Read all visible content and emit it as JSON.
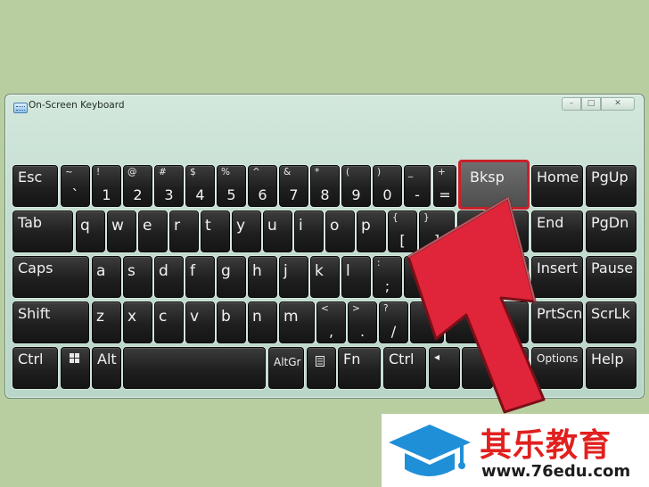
{
  "window": {
    "title": "On-Screen Keyboard",
    "controls": [
      "–",
      "□",
      "✕"
    ]
  },
  "keys": {
    "esc": "Esc",
    "tilde": {
      "shift": "~",
      "main": "`"
    },
    "d1": {
      "shift": "!",
      "main": "1"
    },
    "d2": {
      "shift": "@",
      "main": "2"
    },
    "d3": {
      "shift": "#",
      "main": "3"
    },
    "d4": {
      "shift": "$",
      "main": "4"
    },
    "d5": {
      "shift": "%",
      "main": "5"
    },
    "d6": {
      "shift": "^",
      "main": "6"
    },
    "d7": {
      "shift": "&",
      "main": "7"
    },
    "d8": {
      "shift": "*",
      "main": "8"
    },
    "d9": {
      "shift": "(",
      "main": "9"
    },
    "d0": {
      "shift": ")",
      "main": "0"
    },
    "minus": {
      "shift": "_",
      "main": "-"
    },
    "equals": {
      "shift": "+",
      "main": "="
    },
    "bksp": "Bksp",
    "home": "Home",
    "pgup": "PgUp",
    "tab": "Tab",
    "q": "q",
    "w": "w",
    "e": "e",
    "r": "r",
    "t": "t",
    "y": "y",
    "u": "u",
    "i": "i",
    "o": "o",
    "p": "p",
    "lbracket": {
      "shift": "{",
      "main": "["
    },
    "rbracket": {
      "shift": "}",
      "main": "]"
    },
    "end": "End",
    "pgdn": "PgDn",
    "caps": "Caps",
    "a": "a",
    "s": "s",
    "d": "d",
    "f": "f",
    "g": "g",
    "h": "h",
    "j": "j",
    "k": "k",
    "l": "l",
    "semicolon": {
      "shift": ":",
      "main": ";"
    },
    "quote": {
      "shift": "\"",
      "main": "'"
    },
    "insert": "Insert",
    "pause": "Pause",
    "shift": "Shift",
    "z": "z",
    "x": "x",
    "c": "c",
    "v": "v",
    "b": "b",
    "n": "n",
    "m": "m",
    "comma": {
      "shift": "<",
      "main": ","
    },
    "period": {
      "shift": ">",
      "main": "."
    },
    "slash": {
      "shift": "?",
      "main": "/"
    },
    "prtscn": "PrtScn",
    "scrlk": "ScrLk",
    "ctrl": "Ctrl",
    "alt": "Alt",
    "altgr": "AltGr",
    "fn": "Fn",
    "ctrl2": "Ctrl",
    "options": "Options",
    "help": "Help"
  },
  "icons": {
    "windows_key": "windows-logo-icon",
    "menu_key": "context-menu-icon",
    "arrow": "red-pointer-arrow"
  },
  "colors": {
    "background": "#b9cea0",
    "highlight": "#c8202a",
    "arrow": "#e0243a",
    "logo": "#e0211f"
  },
  "watermark": {
    "name": "其乐教育",
    "url": "www.76edu.com"
  }
}
